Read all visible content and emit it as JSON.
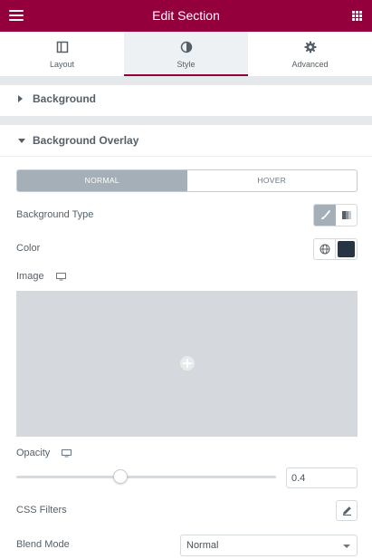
{
  "header": {
    "title": "Edit Section",
    "menu_icon": "hamburger-icon",
    "apps_icon": "grid-icon"
  },
  "tabs": [
    {
      "label": "Layout",
      "icon": "layout-icon",
      "active": false
    },
    {
      "label": "Style",
      "icon": "contrast-icon",
      "active": true
    },
    {
      "label": "Advanced",
      "icon": "gear-icon",
      "active": false
    }
  ],
  "sections": {
    "background": {
      "title": "Background",
      "expanded": false
    },
    "overlay": {
      "title": "Background Overlay",
      "expanded": true
    }
  },
  "overlay": {
    "state_toggle": {
      "normal": "NORMAL",
      "hover": "HOVER",
      "selected": "NORMAL"
    },
    "background_type": {
      "label": "Background Type",
      "options": [
        "classic-brush-icon",
        "gradient-icon"
      ],
      "selected": "classic"
    },
    "color": {
      "label": "Color",
      "value": "#273444"
    },
    "image": {
      "label": "Image",
      "responsive_icon": "desktop-icon"
    },
    "opacity": {
      "label": "Opacity",
      "value": "0.4",
      "fraction": 0.4,
      "responsive_icon": "desktop-icon"
    },
    "css_filters": {
      "label": "CSS Filters",
      "edit_icon": "pencil-icon"
    },
    "blend_mode": {
      "label": "Blend Mode",
      "value": "Normal"
    }
  },
  "colors": {
    "accent": "#93003c",
    "toggle_active": "#a4afb7",
    "image_placeholder": "#d5d8dc"
  }
}
